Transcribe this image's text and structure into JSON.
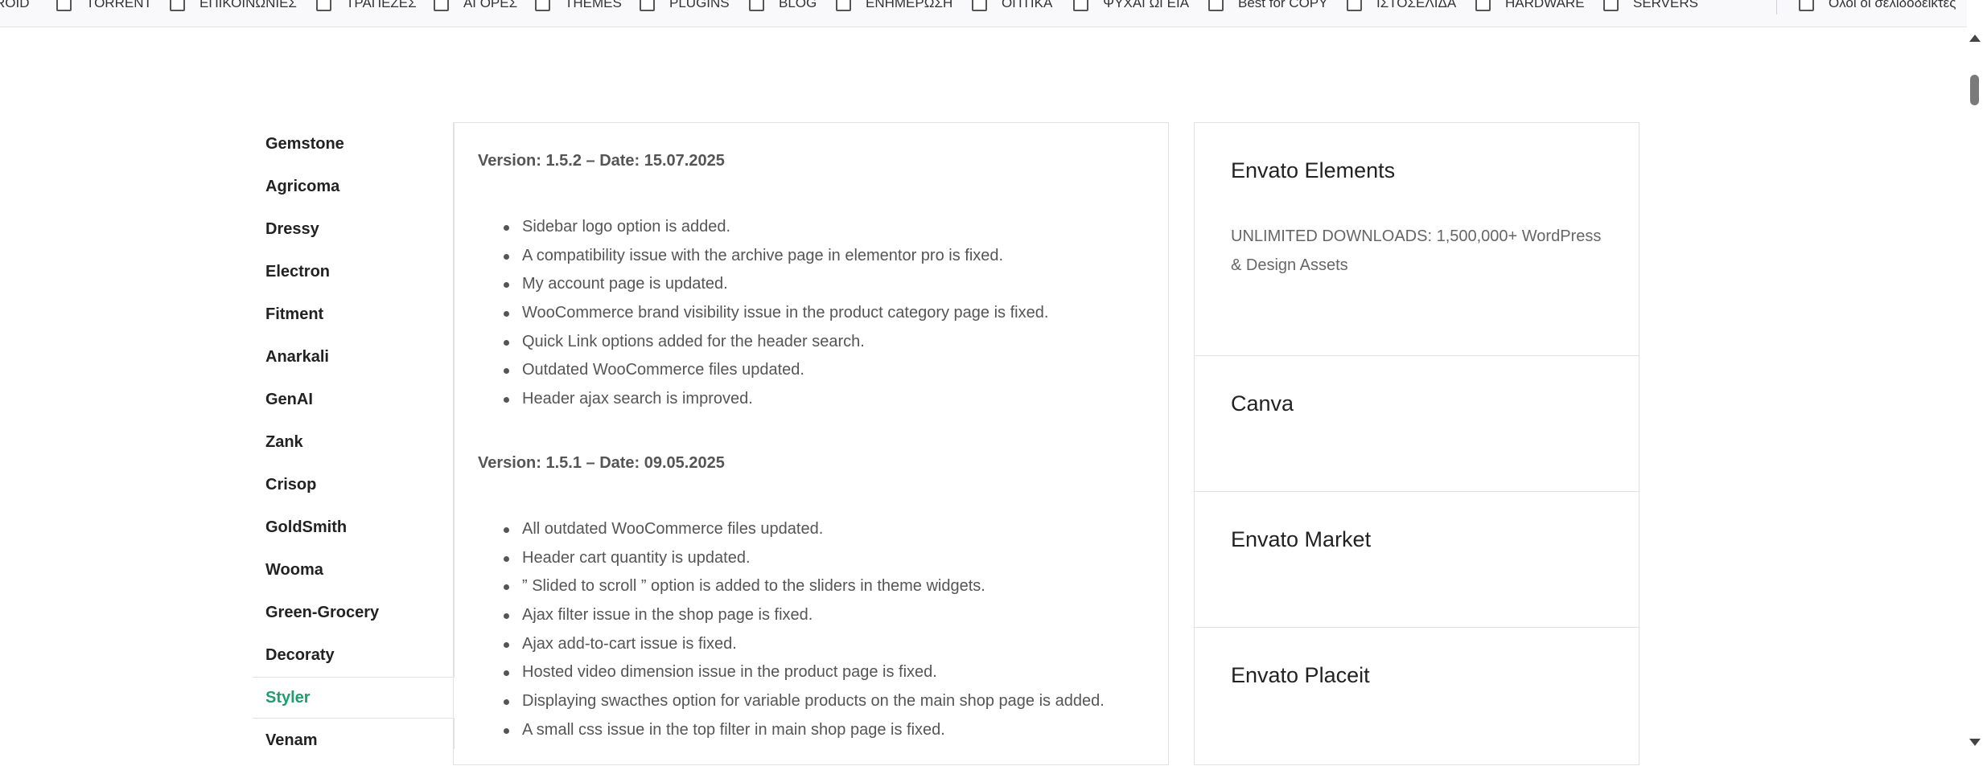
{
  "bookmarks": [
    {
      "label": "ROID"
    },
    {
      "label": "TORRENT"
    },
    {
      "label": "ΕΠΙΚΟΙΝΩΝΙΕΣ"
    },
    {
      "label": "ΤΡΑΠΕΖΕΣ"
    },
    {
      "label": "ΑΓΟΡΕΣ"
    },
    {
      "label": "THEMES"
    },
    {
      "label": "PLUGINS"
    },
    {
      "label": "BLOG"
    },
    {
      "label": "ΕΝΗΜΕΡΩΣΗ"
    },
    {
      "label": "ΟΠΤΙΚΑ"
    },
    {
      "label": "ΨΥΧΑΓΩΓΕΙΑ"
    },
    {
      "label": "Best for COPY"
    },
    {
      "label": "ΙΣΤΟΣΕΛΙΔΑ"
    },
    {
      "label": "HARDWARE"
    },
    {
      "label": "SERVERS"
    },
    {
      "label": "Όλοι οι σελιδοδείκτες"
    }
  ],
  "themes": {
    "items": [
      {
        "label": "Gemstone"
      },
      {
        "label": "Agricoma"
      },
      {
        "label": "Dressy"
      },
      {
        "label": "Electron"
      },
      {
        "label": "Fitment"
      },
      {
        "label": "Anarkali"
      },
      {
        "label": "GenAI"
      },
      {
        "label": "Zank"
      },
      {
        "label": "Crisop"
      },
      {
        "label": "GoldSmith"
      },
      {
        "label": "Wooma"
      },
      {
        "label": "Green-Grocery"
      },
      {
        "label": "Decoraty"
      },
      {
        "label": "Styler"
      },
      {
        "label": "Venam"
      }
    ],
    "active": "Styler",
    "active_color": "#1e9e6f"
  },
  "changelog": {
    "versions": [
      {
        "heading": "Version: 1.5.2 – Date: 15.07.2025",
        "changes": [
          "Sidebar logo option is added.",
          "A compatibility issue with the archive page in elementor pro is fixed.",
          "My account page is updated.",
          "WooCommerce brand visibility issue in the product category page is fixed.",
          "Quick Link options added for the header search.",
          "Outdated WooCommerce files updated.",
          "Header ajax search is improved."
        ]
      },
      {
        "heading": "Version: 1.5.1 – Date: 09.05.2025",
        "changes": [
          "All outdated WooCommerce files updated.",
          "Header cart quantity is updated.",
          "” Slided to scroll ” option is added to the sliders in theme widgets.",
          "Ajax filter issue in the shop page is fixed.",
          "Ajax add-to-cart issue is fixed.",
          "Hosted video dimension issue in the product page is fixed.",
          "Displaying swacthes option for variable products on the main shop page is added.",
          "A small css issue in the top filter in main shop page is fixed."
        ]
      }
    ]
  },
  "sidebar": {
    "cards": [
      {
        "title": "Envato Elements",
        "description": "UNLIMITED DOWNLOADS: 1,500,000+ WordPress & Design Assets"
      },
      {
        "title": "Canva",
        "description": ""
      },
      {
        "title": "Envato Market",
        "description": ""
      },
      {
        "title": "Envato Placeit",
        "description": ""
      }
    ]
  }
}
